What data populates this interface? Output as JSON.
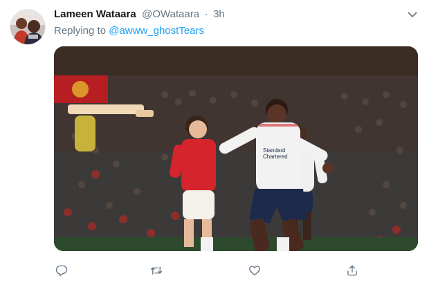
{
  "tweet": {
    "display_name": "Lameen Wataara",
    "handle": "@OWataara",
    "separator": "·",
    "time": "3h",
    "reply_prefix": "Replying to",
    "reply_to": "@awww_ghostTears",
    "avatar_icon": "user-avatar-photo",
    "media": {
      "sponsor_text_line1": "Standard",
      "sponsor_text_line2": "Chartered"
    }
  },
  "actions": {
    "reply_icon": "reply-icon",
    "retweet_icon": "retweet-icon",
    "like_icon": "heart-icon",
    "share_icon": "share-icon"
  },
  "colors": {
    "link": "#1da1f2",
    "secondary_text": "#657786",
    "icon": "#657786",
    "primary_text": "#14171a",
    "red_kit": "#d5242c",
    "white_kit": "#f2f2f2",
    "navy_shorts": "#1d2a4c"
  }
}
